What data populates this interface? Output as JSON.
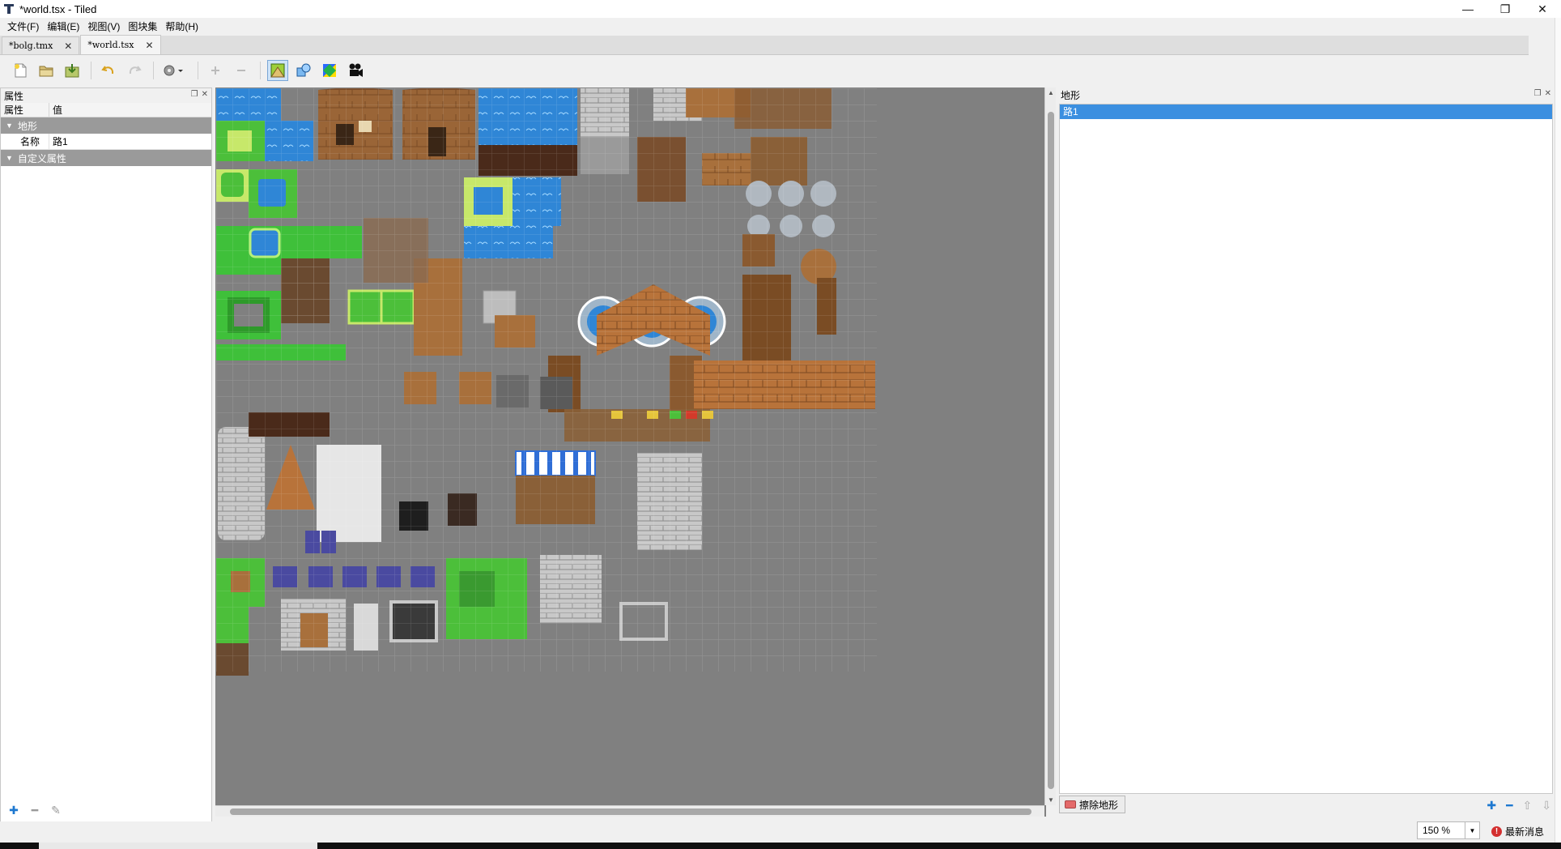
{
  "window": {
    "title": "*world.tsx - Tiled",
    "minimize": "—",
    "restore": "❐",
    "close": "✕"
  },
  "menu": [
    {
      "label": "文件(F)"
    },
    {
      "label": "编辑(E)"
    },
    {
      "label": "视图(V)"
    },
    {
      "label": "图块集"
    },
    {
      "label": "帮助(H)"
    }
  ],
  "tabs": [
    {
      "label": "*bolg.tmx",
      "close": "✕"
    },
    {
      "label": "*world.tsx",
      "close": "✕"
    }
  ],
  "toolbar": {
    "icons": [
      "new-file-icon",
      "open-folder-icon",
      "save-icon",
      "undo-icon",
      "redo-icon",
      "tileset-properties-icon",
      "add-tiles-icon",
      "remove-tiles-icon",
      "terrain-edit-icon",
      "collision-editor-icon",
      "tile-palette-icon",
      "animation-editor-icon"
    ]
  },
  "properties": {
    "title": "属性",
    "col_name": "属性",
    "col_value": "值",
    "group_terrain": "地形",
    "name_label": "名称",
    "name_value": "路1",
    "group_custom": "自定义属性"
  },
  "terrain": {
    "title": "地形",
    "items": [
      "路1"
    ],
    "erase_label": "擦除地形"
  },
  "status": {
    "zoom": "150 %",
    "news_badge": "!",
    "news_label": "最新消息"
  },
  "colors": {
    "canvas_bg": "#808080",
    "selection": "#3b8fe0",
    "accent_blue": "#1e78d0"
  }
}
